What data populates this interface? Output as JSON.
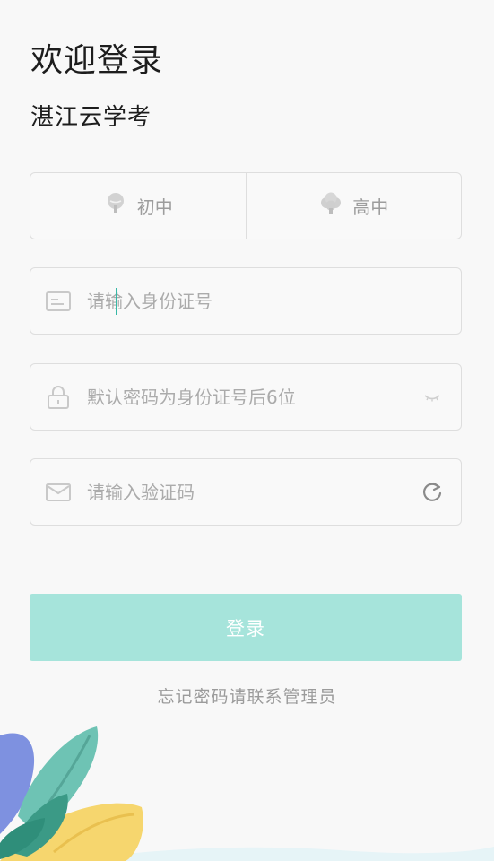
{
  "header": {
    "title": "欢迎登录",
    "subtitle": "湛江云学考"
  },
  "school_level": {
    "options": [
      {
        "label": "初中",
        "icon": "sprout-icon"
      },
      {
        "label": "高中",
        "icon": "tree-icon"
      }
    ]
  },
  "form": {
    "id_number": {
      "placeholder": "请输入身份证号",
      "icon": "id-card-icon"
    },
    "password": {
      "placeholder": "默认密码为身份证号后6位",
      "icon": "lock-icon",
      "toggle_icon": "eye-closed-icon"
    },
    "captcha": {
      "placeholder": "请输入验证码",
      "icon": "mail-icon",
      "refresh_icon": "refresh-icon"
    }
  },
  "actions": {
    "login_label": "登录",
    "forgot_text": "忘记密码请联系管理员"
  },
  "colors": {
    "accent": "#37b8a6",
    "button": "#a6e4db",
    "border": "#dedede",
    "background": "#f8f8f8"
  }
}
